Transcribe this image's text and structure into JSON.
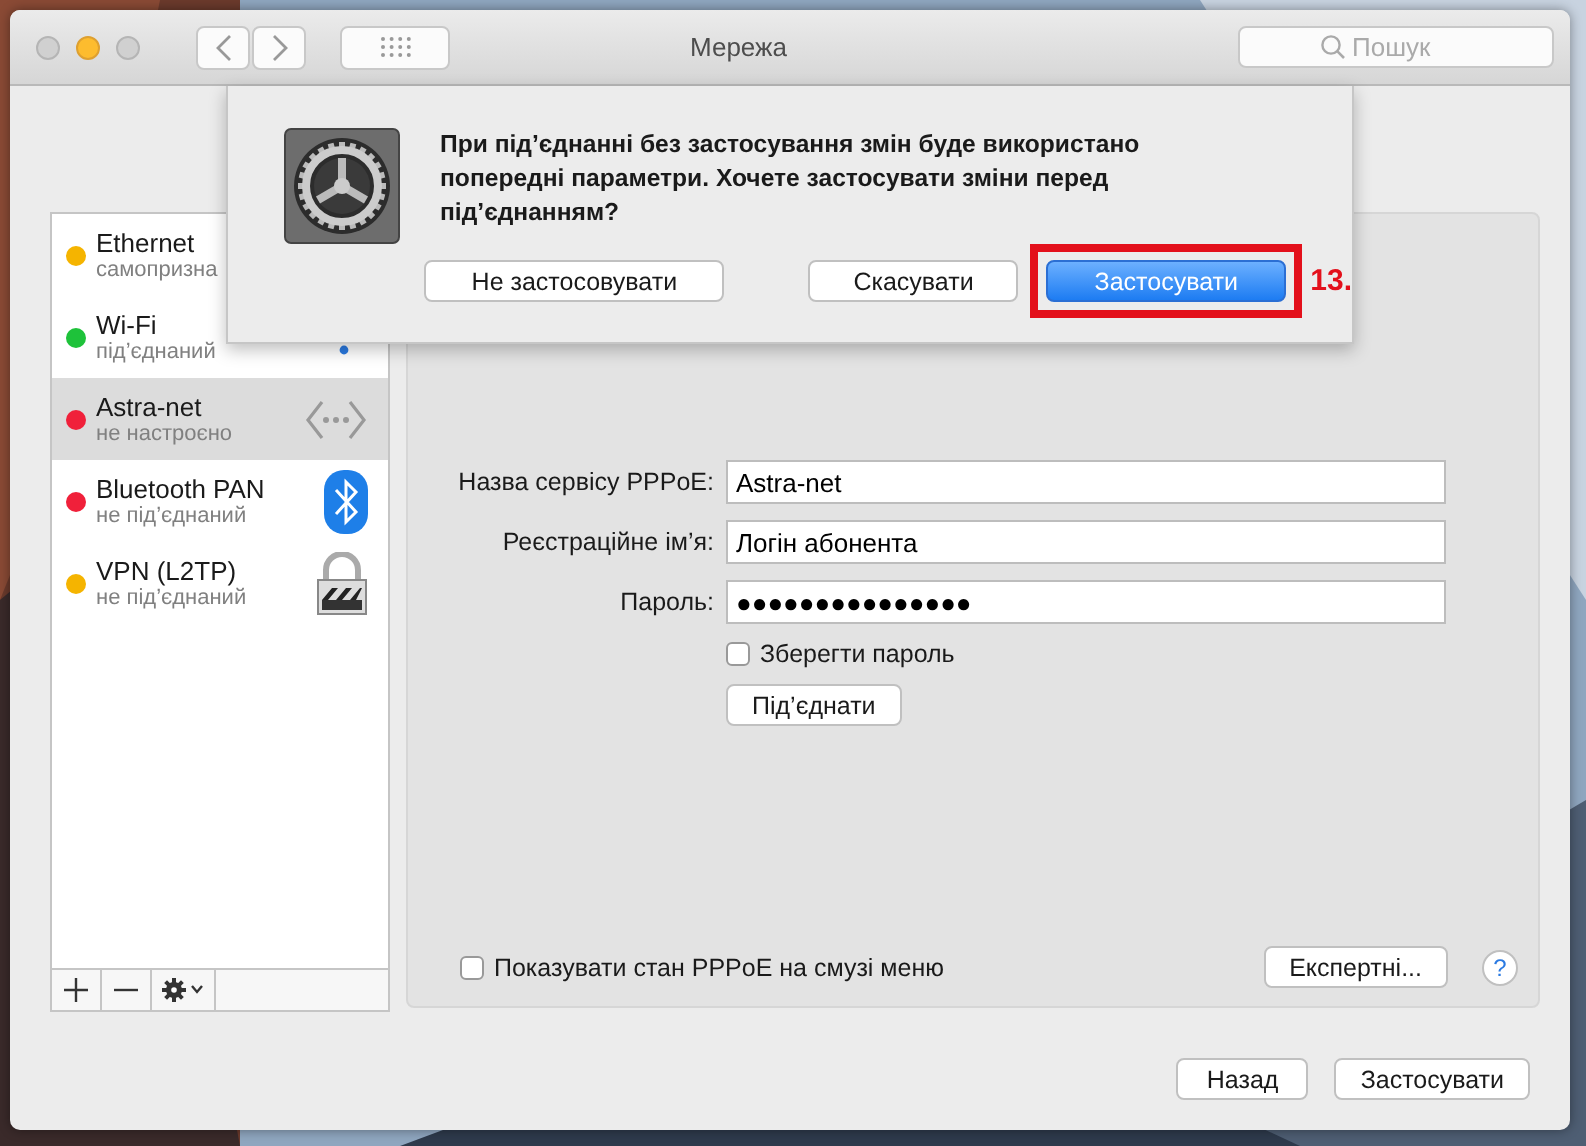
{
  "window": {
    "title": "Мережа"
  },
  "search": {
    "placeholder": "Пошук"
  },
  "services": [
    {
      "name": "Ethernet",
      "status": "самопризна",
      "color": "#f5b400",
      "selected": false
    },
    {
      "name": "Wi-Fi",
      "status": "під’єднаний",
      "color": "#1ec23a",
      "selected": false,
      "kind": "wifi"
    },
    {
      "name": "Astra-net",
      "status": "не настроєно",
      "color": "#f0203a",
      "selected": true,
      "kind": "dots"
    },
    {
      "name": "Bluetooth PAN",
      "status": "не під’єднаний",
      "color": "#f0203a",
      "selected": false,
      "kind": "bluetooth"
    },
    {
      "name": "VPN (L2TP)",
      "status": "не під’єднаний",
      "color": "#f5b400",
      "selected": false,
      "kind": "lock"
    }
  ],
  "form": {
    "fields": [
      {
        "label": "Назва сервісу PPPoE:",
        "value": "Astra-net"
      },
      {
        "label": "Реєстраційне ім’я:",
        "value": "Логін абонента"
      },
      {
        "label": "Пароль:",
        "value": "●●●●●●●●●●●●●●●"
      }
    ],
    "save_password": {
      "label": "Зберегти пароль",
      "checked": false
    },
    "connect_button": "Під’єднати",
    "show_status": {
      "label": "Показувати стан PPPoE на смузі меню",
      "checked": false
    },
    "advanced_button": "Експертні...",
    "help": "?"
  },
  "buttons": [
    {
      "label": "Назад"
    },
    {
      "label": "Застосувати"
    }
  ],
  "dialog": {
    "message": "При під’єднанні без застосування змін буде використано попередні параметри. Хочете застосувати зміни перед під’єднанням?",
    "buttons": [
      {
        "label": "Не застосовувати",
        "default": false,
        "highlighted": false
      },
      {
        "label": "Скасувати",
        "default": false,
        "highlighted": false
      },
      {
        "label": "Застосувати",
        "default": true,
        "highlighted": true
      }
    ],
    "annotation": "13."
  }
}
